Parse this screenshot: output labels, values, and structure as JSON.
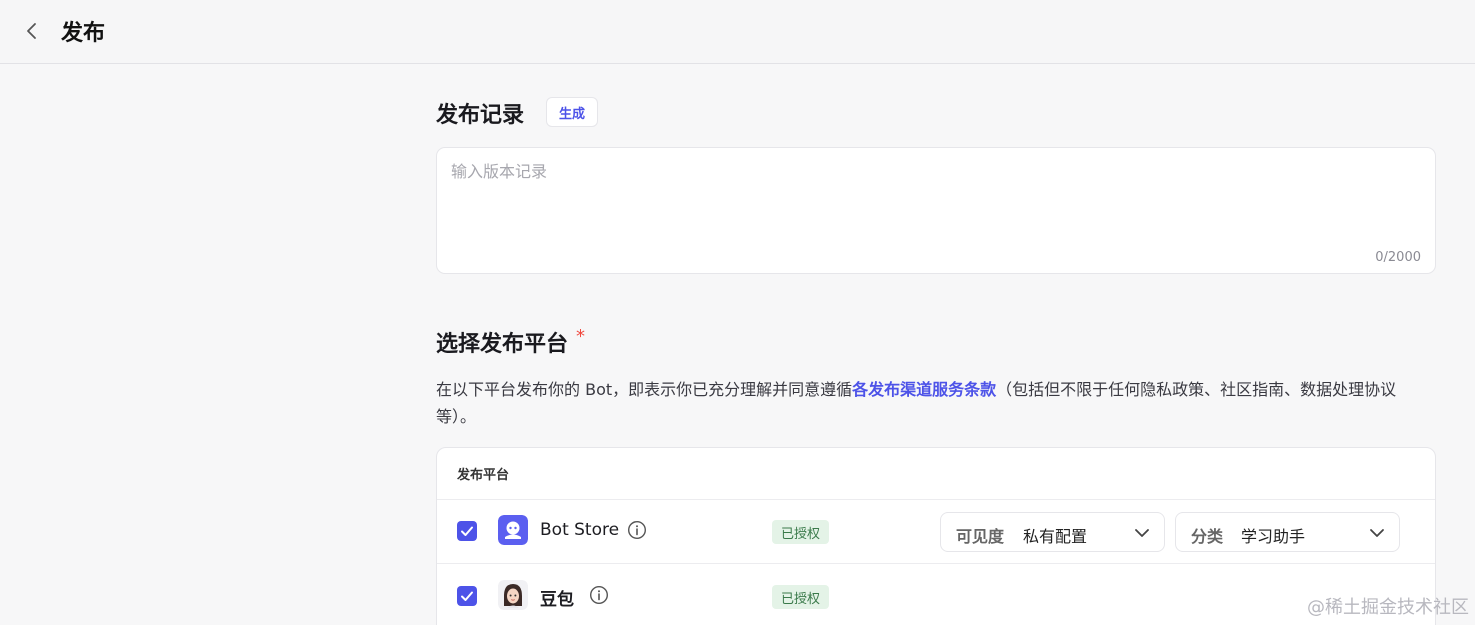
{
  "header": {
    "title": "发布"
  },
  "record": {
    "title": "发布记录",
    "generate_label": "生成",
    "placeholder": "输入版本记录",
    "counter": "0/2000"
  },
  "platform": {
    "title": "选择发布平台",
    "required_mark": "*",
    "desc_before": "在以下平台发布你的 Bot，即表示你已充分理解并同意遵循",
    "desc_link": "各发布渠道服务条款",
    "desc_after": "（包括但不限于任何隐私政策、社区指南、数据处理协议等）。",
    "table_header": "发布平台",
    "rows": [
      {
        "name": "Bot Store",
        "status": "已授权",
        "visibility_label": "可见度",
        "visibility_value": "私有配置",
        "category_label": "分类",
        "category_value": "学习助手"
      },
      {
        "name": "豆包",
        "status": "已授权"
      }
    ]
  },
  "watermark": "@稀土掘金技术社区",
  "colors": {
    "accent": "#4d53e8",
    "badge_bg": "#e4f3e7",
    "required": "#f0483e"
  }
}
